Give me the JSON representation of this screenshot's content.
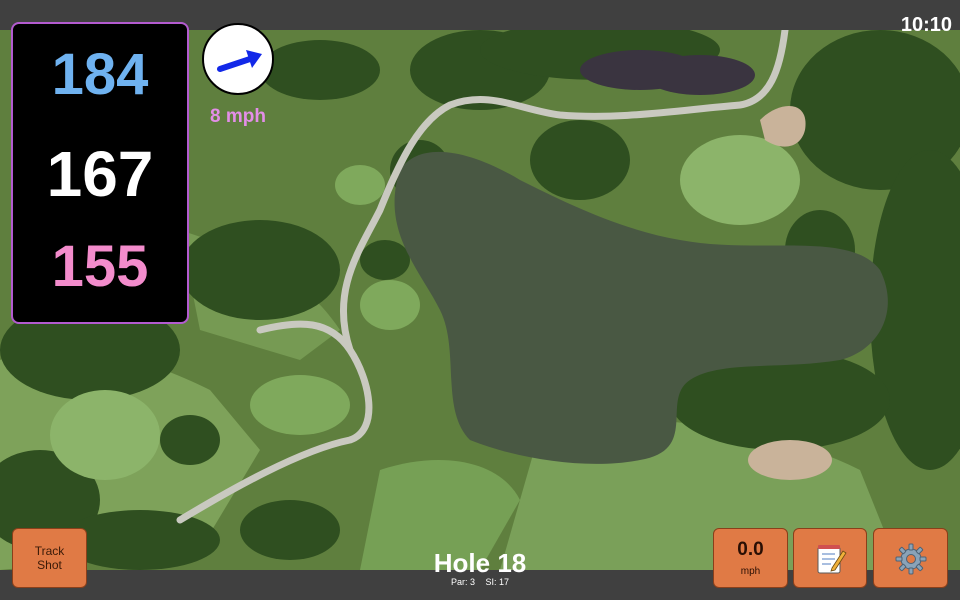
{
  "clock": "10:10",
  "distances": {
    "back": "184",
    "center": "167",
    "front": "155"
  },
  "wind": {
    "speed_label": "8 mph",
    "arrow_icon": "arrow-right-icon"
  },
  "track_button": {
    "line1": "Track",
    "line2": "Shot"
  },
  "speed_button": {
    "value": "0.0",
    "unit": "mph"
  },
  "notes_button": {
    "icon": "notepad-icon"
  },
  "settings_button": {
    "icon": "gear-icon"
  },
  "hole": {
    "title": "Hole 18",
    "par_label": "Par: 3",
    "si_label": "SI: 17"
  },
  "colors": {
    "back_distance": "#6fb2f0",
    "center_distance": "#ffffff",
    "front_distance": "#f38ccc",
    "wind_label": "#e38ee8",
    "button": "#e07a45",
    "wind_arrow": "#1228e8"
  }
}
